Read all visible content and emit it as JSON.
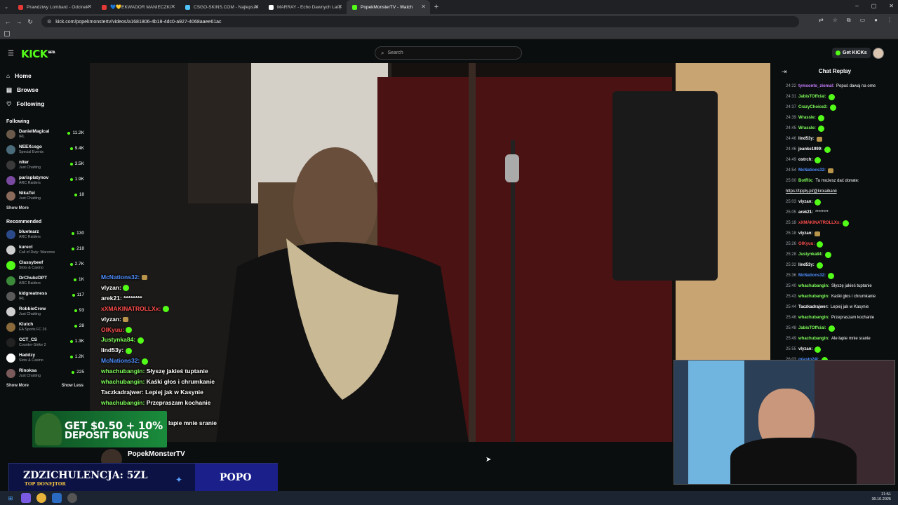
{
  "browser": {
    "tabs": [
      {
        "label": "Prawdziwy Lombard - Odcinek",
        "color": "#e53935"
      },
      {
        "label": "💙💛EKWADOR MANIECZKI",
        "color": "#e53935"
      },
      {
        "label": "CSGO-SKINS.COM - Najlepsze",
        "color": "#4fc3f7"
      },
      {
        "label": "MARRAY - Echo Dawnych Lat |",
        "color": "#ffffff"
      },
      {
        "label": "PopekMonsterTV - Watch",
        "color": "#53fc18"
      }
    ],
    "url": "kick.com/popekmonstertv/videos/a1681806-4b18-4dc0-a927-4068aaee61ac",
    "controls": {
      "back": "←",
      "forward": "→",
      "reload": "↻",
      "new_tab": "+",
      "minimize": "–",
      "maximize": "▢",
      "close": "✕"
    }
  },
  "header": {
    "logo": "KICK",
    "logo_badge": "BETA",
    "search_placeholder": "Search",
    "get_kicks": "Get KICKs"
  },
  "sidebar": {
    "nav": [
      {
        "label": "Home",
        "icon": "home-icon",
        "glyph": "⌂"
      },
      {
        "label": "Browse",
        "icon": "browse-icon",
        "glyph": "▤"
      },
      {
        "label": "Following",
        "icon": "heart-icon",
        "glyph": "♡"
      }
    ],
    "following_title": "Following",
    "following": [
      {
        "name": "DanielMagical",
        "category": "IRL",
        "viewers": "11.2K",
        "color": "#6b5a4a"
      },
      {
        "name": "NEEXcsgo",
        "category": "Special Events",
        "viewers": "9.4K",
        "color": "#4a6b7a"
      },
      {
        "name": "nlter",
        "category": "Just Chatting",
        "viewers": "3.5K",
        "color": "#3a3a3a"
      },
      {
        "name": "parisplatynov",
        "category": "ARC Raiders",
        "viewers": "1.9K",
        "color": "#7a4aa0"
      },
      {
        "name": "NikaTel",
        "category": "Just Chatting",
        "viewers": "18",
        "color": "#8a6a5a"
      }
    ],
    "show_more_following": "Show More",
    "recommended_title": "Recommended",
    "recommended": [
      {
        "name": "bluetearz",
        "category": "ARC Raiders",
        "viewers": "130",
        "color": "#2a4a8a"
      },
      {
        "name": "kurect",
        "category": "Call of Duty: Warzone",
        "viewers": "218",
        "color": "#cfcfcf"
      },
      {
        "name": "Classybeef",
        "category": "Slots & Casino",
        "viewers": "2.7K",
        "color": "#53fc18"
      },
      {
        "name": "DrChubzDPT",
        "category": "ARC Raiders",
        "viewers": "1K",
        "color": "#3a8a3a"
      },
      {
        "name": "kidgreatness",
        "category": "IRL",
        "viewers": "117",
        "color": "#5a5a5a"
      },
      {
        "name": "RobbieCrow",
        "category": "Just Chatting",
        "viewers": "93",
        "color": "#cfcfcf"
      },
      {
        "name": "Klutch",
        "category": "EA Sports FC 26",
        "viewers": "28",
        "color": "#8a6a3a"
      },
      {
        "name": "CCT_CS",
        "category": "Counter-Strike 2",
        "viewers": "1.3K",
        "color": "#222222"
      },
      {
        "name": "Haddzy",
        "category": "Slots & Casino",
        "viewers": "1.2K",
        "color": "#ffffff"
      },
      {
        "name": "Rinoksa",
        "category": "Just Chatting",
        "viewers": "225",
        "color": "#7a5a5a"
      }
    ],
    "show_more": "Show More",
    "show_less": "Show Less"
  },
  "video_overlay_chat": [
    {
      "user": "McNations32:",
      "color": "#4f8fff",
      "emote": "box"
    },
    {
      "user": "vlyzan:",
      "color": "#ffffff",
      "emote": "green"
    },
    {
      "user": "arek21:",
      "color": "#ffffff",
      "text": "********"
    },
    {
      "user": "xXMAKINATROLLXx:",
      "color": "#ff4d4d",
      "emote": "green"
    },
    {
      "user": "vlyzan:",
      "color": "#ffffff",
      "emote": "box"
    },
    {
      "user": "OIKyuu:",
      "color": "#ff4d4d",
      "emote": "green"
    },
    {
      "user": "Justynka84:",
      "color": "#7fff5a",
      "emote": "green"
    },
    {
      "user": "lind53y:",
      "color": "#ffffff",
      "emote": "green"
    },
    {
      "user": "McNations32:",
      "color": "#4f8fff",
      "emote": "green"
    },
    {
      "user": "whachubangin:",
      "color": "#7fff5a",
      "text": "Słyszę jakieś tuptanie"
    },
    {
      "user": "whachubangin:",
      "color": "#7fff5a",
      "text": "Kaśki głos i chrumkanie"
    },
    {
      "user": "Taczkadrajwer:",
      "color": "#ffffff",
      "text": "Lepiej jak w Kasynie"
    },
    {
      "user": "whachubangin:",
      "color": "#7fff5a",
      "text": "Przepraszam kochanie"
    }
  ],
  "overlay_tail_text": "lapie mnie sranie",
  "bonus_banner": {
    "line1": "GET $0.50 + 10%",
    "line2": "DEPOSIT BONUS"
  },
  "streamer_name": "PopekMonsterTV",
  "donation": {
    "title": "ZDZICHULENCJA: 5ZL",
    "subtitle": "TOP DONEJTOR",
    "right": "POPO"
  },
  "chat_replay": {
    "title": "Chat Replay",
    "messages": [
      {
        "time": "24:22",
        "user": "tymsonto_ziomal:",
        "color": "#c77dff",
        "text": "Popuś dawaj na ome"
      },
      {
        "time": "24:31",
        "user": "JabisTOffcial:",
        "color": "#7fff5a",
        "emote": "green"
      },
      {
        "time": "24:37",
        "user": "CrazyChoice2:",
        "color": "#7fff5a",
        "emote": "green"
      },
      {
        "time": "24:39",
        "user": "Wrassle:",
        "color": "#7fff5a",
        "emote": "green"
      },
      {
        "time": "24:45",
        "user": "Wrassle:",
        "color": "#7fff5a",
        "emote": "green"
      },
      {
        "time": "24:46",
        "user": "lind53y:",
        "color": "#ffffff",
        "emote": "box"
      },
      {
        "time": "24:46",
        "user": "jeanke1999:",
        "color": "#ffffff",
        "emote": "green"
      },
      {
        "time": "24:49",
        "user": "ostrch:",
        "color": "#ffffff",
        "emote": "green"
      },
      {
        "time": "24:54",
        "user": "McNations32:",
        "color": "#4f8fff",
        "emote": "box"
      },
      {
        "time": "25:00",
        "user": "BotRix:",
        "color": "#7fff5a",
        "text": "Tu możesz dać donate:",
        "link": "https://tipply.pl/@kroiaibanii"
      },
      {
        "time": "25:03",
        "user": "vlyzan:",
        "color": "#ffffff",
        "emote": "green"
      },
      {
        "time": "25:05",
        "user": "arek21:",
        "color": "#ffffff",
        "text": "********"
      },
      {
        "time": "25:18",
        "user": "xXMAKINATROLLXx:",
        "color": "#ff4d4d",
        "emote": "green"
      },
      {
        "time": "25:18",
        "user": "vlyzan:",
        "color": "#ffffff",
        "emote": "box"
      },
      {
        "time": "25:26",
        "user": "OIKyuu:",
        "color": "#ff4d4d",
        "emote": "green"
      },
      {
        "time": "25:28",
        "user": "Justynka84:",
        "color": "#7fff5a",
        "emote": "green"
      },
      {
        "time": "25:32",
        "user": "lind53y:",
        "color": "#ffffff",
        "emote": "green"
      },
      {
        "time": "25:36",
        "user": "McNations32:",
        "color": "#4f8fff",
        "emote": "green"
      },
      {
        "time": "25:40",
        "user": "whachubangin:",
        "color": "#7fff5a",
        "text": "Słyszę jakieś tuptanie"
      },
      {
        "time": "25:43",
        "user": "whachubangin:",
        "color": "#7fff5a",
        "text": "Kaśki głos i chrumkanie"
      },
      {
        "time": "25:44",
        "user": "Taczkadrajwer:",
        "color": "#ffffff",
        "text": "Lepiej jak w Kasynie"
      },
      {
        "time": "25:46",
        "user": "whachubangin:",
        "color": "#7fff5a",
        "text": "Przepraszam kochanie"
      },
      {
        "time": "25:48",
        "user": "JabisTOffcial:",
        "color": "#7fff5a",
        "emote": "green"
      },
      {
        "time": "25:49",
        "user": "whachubangin:",
        "color": "#7fff5a",
        "text": "Ale łapie mnie sranie"
      },
      {
        "time": "25:55",
        "user": "vlyzan:",
        "color": "#ffffff",
        "emote": "green"
      },
      {
        "time": "26:03",
        "user": "miasto24l:",
        "color": "#4f8fff",
        "emote": "green"
      }
    ]
  },
  "taskbar": {
    "time": "21:51",
    "date": "30.10.2025"
  },
  "colors": {
    "accent": "#53fc18",
    "bg": "#0b0e0f"
  }
}
